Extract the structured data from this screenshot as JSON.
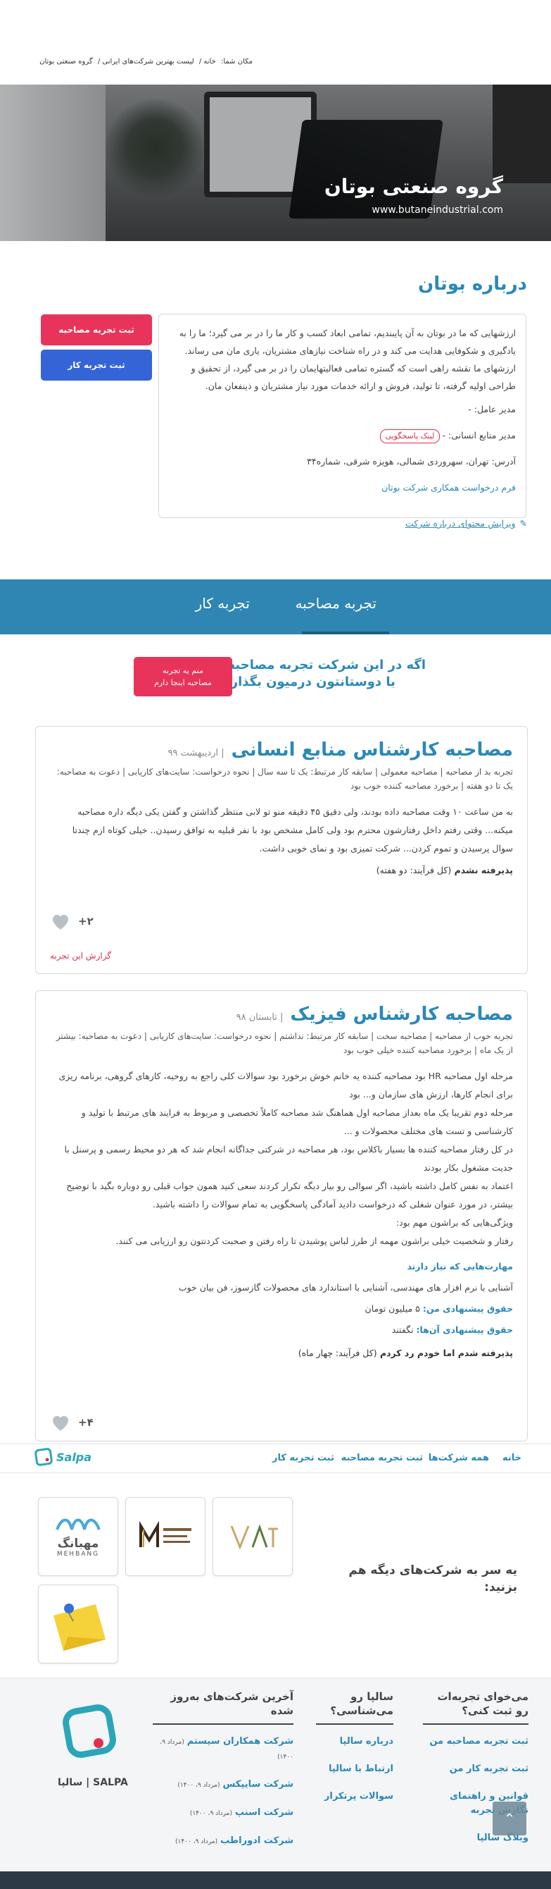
{
  "breadcrumb": {
    "prefix": "مکان شما:",
    "items": [
      "خانه",
      "لیست بهترین شرکت‌های ایرانی",
      "گروه صنعتی بوتان"
    ],
    "separator": "/"
  },
  "hero": {
    "company_name": "گروه صنعتی بوتان",
    "website": "www.butaneindustrial.com"
  },
  "about": {
    "title": "درباره بوتان",
    "description": "ارزشهایی که ما در بوتان به آن پایبندیم، تمامی ابعاد کسب و کار ما را در بر می گیرد؛ ما را به یادگیری و شکوفایی هدایت می کند و در راه شناخت نیازهای مشتریان، یاری مان می رساند. ارزشهای ما نقشه راهی است که گستره تمامی فعالیتهایمان را در بر می گیرد، از تحقیق و طراحی اولیه گرفته، تا تولید، فروش و ارائه خدمات مورد نیاز مشتریان و ذینفعان مان.",
    "ceo_label": "مدیر عامل: -",
    "hr_label": "مدیر منابع انسانی: -",
    "response_link": "لینک پاسخگویی",
    "address": "آدرس: تهران، سهروردی شمالی، هویزه شرقی، شماره۳۴",
    "partner_request": "فرم درخواست همکاری شرکت بوتان",
    "edit_link": "ویرایش محتوای درباره شرکت"
  },
  "actions": {
    "submit_interview": "ثبت تجربه مصاحبه",
    "submit_work": "ثبت تجربه کار"
  },
  "tabs": {
    "interview": "تجربه مصاحبه",
    "work": "تجربه کار"
  },
  "cta": {
    "line1": "اگه در این شرکت تجربه مصاحبه دارید،",
    "line2": "با دوستانتون درمیون بگذارید",
    "button_line1": "منم یه تجربه",
    "button_line2": "مصاحبه اینجا دارم"
  },
  "interviews": [
    {
      "title": "مصاحبه کارشناس منابع انسانی",
      "date": "| اردیبهشت ۹۹",
      "meta": "تجربه بد از مصاحبه | مصاحبه معمولی | سابقه کار مرتبط: یک تا سه سال | نحوه درخواست: سایت‌های کاریابی | دعوت به مصاحبه: یک تا دو هفته | برخورد مصاحبه کننده خوب بود",
      "body": "به من ساعت ۱۰ وقت مصاحبه داده بودند، ولی دقیق ۴۵ دقیقه منو تو لابی منتظر گذاشتن و گفتن یکی دیگه داره مصاحبه میکنه... وقتی رفتم داخل رفتارشون محترم بود ولی کامل مشخص بود با نفر قبلیه به توافق رسیدن.. خیلی کوتاه ازم چندتا سوال پرسیدن و تموم کردن... شرکت تمیزی بود و نمای خوبی داشت.",
      "result": "پذیرفته نشدم",
      "result_detail": "(کل فرآیند: دو هفته)",
      "likes": "+۲",
      "report": "گزارش این تجربه"
    },
    {
      "title": "مصاحبه کارشناس فیزیک",
      "date": "| تابستان ۹۸",
      "meta": "تجربه خوب از مصاحبه | مصاحبه سخت | سابقه کار مرتبط: نداشتم | نحوه درخواست: سایت‌های کاریابی | دعوت به مصاحبه: بیشتر از یک ماه | برخورد مصاحبه کننده خیلی خوب بود",
      "body_lines": [
        "مرحله اول مصاحبه HR بود مصاحبه کننده یه خانم خوش برخورد بود سوالات کلی راجع به روحیه، کارهای گروهی، برنامه ریزی برای انجام کارها، ارزش های سازمان و... بود",
        "مرحله دوم تقریبا یک ماه بعداز مصاحبه اول هماهنگ شد مصاحبه کاملاً تخصصی و مربوط به فرایند های مرتبط با تولید و کارشناسی و تست های مختلف محصولات و ...",
        "در کل رفتار مصاحبه کننده ها بسیار باکلاس بود، هر مصاحبه در شرکتی جداگانه انجام شد که هر دو محیط رسمی و پرسنل با جدیت مشغول بکار بودند",
        "اعتماد به نفس کامل داشته باشید، اگر سوالی رو بیار دیگه تکرار کردند سعی کنید همون جواب قبلی رو دوباره بگید با توضیح بیشتر، در مورد عنوان شغلی که درخواست دادید آمادگی پاسخگویی به تمام سوالات را داشته باشید.",
        "ویژگی‌هایی که براشون مهم بود:",
        "رفتار و شخصیت خیلی براشون مهمه از طرز لباس پوشیدن تا راه رفتن و صحبت کردنتون رو ارزیابی می کنند."
      ],
      "skills_title": "مهارت‌هایی که نیاز دارند",
      "skills": "آشنایی با نرم افزار های مهندسی، آشنایی با استاندارد های محصولات گازسوز، فن بیان خوب",
      "salary_mine_label": "حقوق پیشنهادی من:",
      "salary_mine": "۵ میلیون تومان",
      "salary_theirs_label": "حقوق پیشنهادی آن‌ها:",
      "salary_theirs": "نگفتند",
      "result": "پذیرفته شدم اما خودم رد کردم",
      "result_detail": "(کل فرآیند: چهار ماه)",
      "likes": "+۴"
    }
  ],
  "bottom_nav": {
    "items": [
      "خانه",
      "همه شرکت‌ها",
      "ثبت تجربه مصاحبه",
      "ثبت تجربه کار"
    ],
    "brand": "Salpa"
  },
  "others": {
    "title": "یه سر به شرکت‌های دیگه هم بزنید:",
    "logos": [
      {
        "icon": "vat-logo",
        "text": "VAT"
      },
      {
        "icon": "m-group-logo",
        "text": "M"
      },
      {
        "icon": "mehbang-logo",
        "text": "مهبانگ",
        "sub": "MEHBANG"
      },
      {
        "icon": "sticky-note-logo",
        "text": ""
      }
    ]
  },
  "footer": {
    "col1_title": "می‌خوای تجربه‌ات رو ثبت کنی؟",
    "col1_links": [
      "ثبت تجربه مصاحبه من",
      "ثبت تجربه کار من",
      "قوانین و راهنمای نگارش تجربه",
      "وبلاگ سالپا"
    ],
    "col2_title": "سالپا رو می‌شناسی؟",
    "col2_links": [
      "درباره سالپا",
      "ارتباط با سالپا",
      "سوالات پرتکرار"
    ],
    "col3_title": "آخرین شرکت‌های به‌روز شده",
    "companies": [
      {
        "name": "شرکت همکاران سیستم",
        "date": "(مرداد ۹، ۱۴۰۰)"
      },
      {
        "name": "شرکت سایپکس",
        "date": "(مرداد ۹، ۱۴۰۰)"
      },
      {
        "name": "شرکت اسنپ",
        "date": "(مرداد ۹، ۱۴۰۰)"
      },
      {
        "name": "شرکت ادوراطب",
        "date": "(مرداد ۹، ۱۴۰۰)"
      }
    ],
    "brand": "SALPA | سالپا"
  },
  "colors": {
    "accent_blue": "#2a88b8",
    "band_blue": "#2f86b3",
    "accent_red": "#e8345a",
    "button_blue": "#3564d6"
  }
}
